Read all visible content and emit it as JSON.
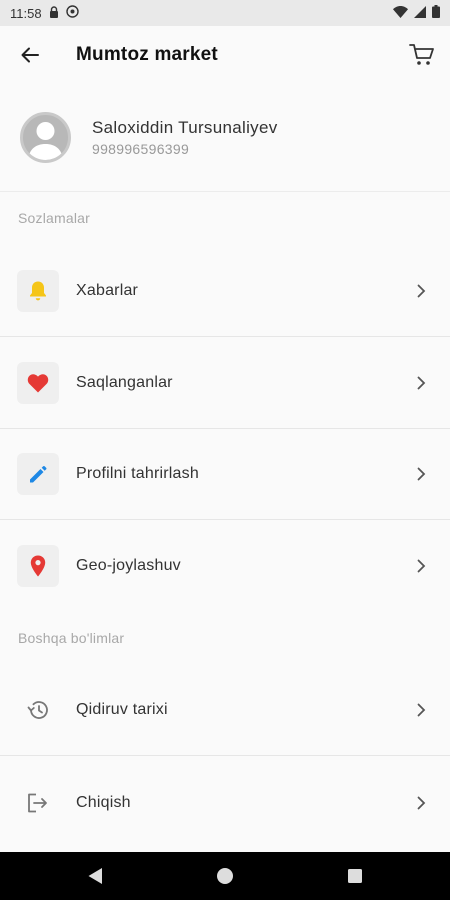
{
  "status_bar": {
    "time": "11:58"
  },
  "app_bar": {
    "title": "Mumtoz market"
  },
  "profile": {
    "name": "Saloxiddin Tursunaliyev",
    "phone": "998996596399"
  },
  "settings_section": {
    "label": "Sozlamalar",
    "items": [
      {
        "label": "Xabarlar",
        "icon": "bell-icon",
        "icon_color": "#f5c518"
      },
      {
        "label": "Saqlanganlar",
        "icon": "heart-icon",
        "icon_color": "#e53935"
      },
      {
        "label": "Profilni tahrirlash",
        "icon": "pencil-icon",
        "icon_color": "#1e88e5"
      },
      {
        "label": "Geo-joylashuv",
        "icon": "location-pin-icon",
        "icon_color": "#e53935"
      }
    ]
  },
  "other_section": {
    "label": "Boshqa bo'limlar",
    "items": [
      {
        "label": "Qidiruv tarixi",
        "icon": "history-icon"
      },
      {
        "label": "Chiqish",
        "icon": "logout-icon"
      }
    ]
  }
}
